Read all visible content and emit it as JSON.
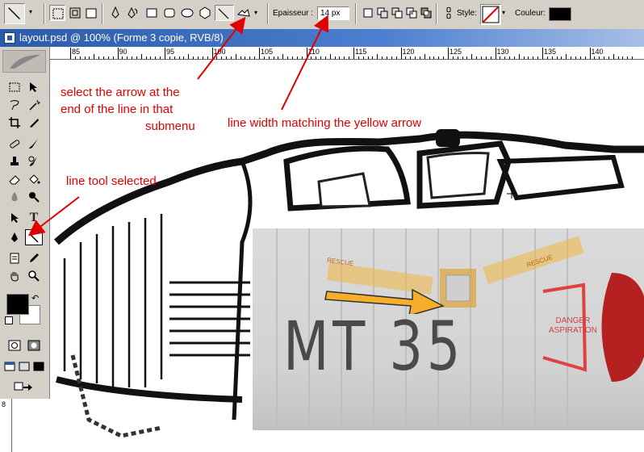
{
  "options_bar": {
    "epaisseur_label": "Epaisseur :",
    "epaisseur_value": "14 px",
    "style_label": "Style:",
    "couleur_label": "Couleur:",
    "couleur_value": "#000000"
  },
  "document": {
    "title": "layout.psd @ 100% (Forme 3 copie, RVB/8)"
  },
  "toolbox": {
    "type_tool": "T",
    "foreground_color": "#000000",
    "background_color": "#ffffff"
  },
  "ruler": {
    "h_labels": [
      "85",
      "90",
      "95",
      "100",
      "105",
      "110",
      "115",
      "120",
      "125",
      "130",
      "135",
      "140"
    ],
    "v_label": "8"
  },
  "annotations": {
    "arrow_head": [
      "select the arrow at the",
      "end of the line in that",
      "submenu"
    ],
    "line_width": "line width matching the yellow arrow",
    "line_tool": "line tool selected"
  },
  "artwork": {
    "mt35": "MT 35",
    "danger": [
      "DANGER",
      "ASPIRATION"
    ],
    "stencil": "RESCUE"
  }
}
